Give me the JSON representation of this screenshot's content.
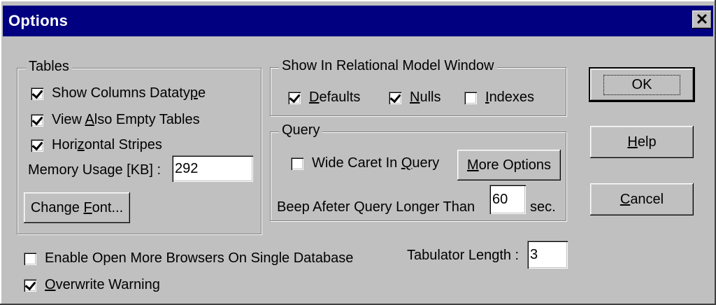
{
  "window": {
    "title": "Options",
    "close_glyph": "✕"
  },
  "tables": {
    "legend": "Tables",
    "show_columns_datatype": {
      "label_pre": "Show Columns Dataty",
      "label_ul": "p",
      "label_post": "e",
      "checked": true
    },
    "view_empty_tables": {
      "label_pre": "View ",
      "label_ul": "A",
      "label_post": "lso Empty Tables",
      "checked": true
    },
    "horizontal_stripes": {
      "label_pre": "Hori",
      "label_ul": "z",
      "label_post": "ontal Stripes",
      "checked": true
    },
    "memory_label": "Memory Usage [KB] :",
    "memory_value": "292",
    "change_font": {
      "pre": "Change ",
      "ul": "F",
      "post": "ont..."
    }
  },
  "relational": {
    "legend": "Show In Relational Model Window",
    "defaults": {
      "ul": "D",
      "rest": "efaults",
      "checked": true
    },
    "nulls": {
      "ul": "N",
      "rest": "ulls",
      "checked": true
    },
    "indexes": {
      "ul": "I",
      "rest": "ndexes",
      "checked": false
    }
  },
  "query": {
    "legend": "Query",
    "wide_caret": {
      "label_pre": "Wide Caret In ",
      "label_ul": "Q",
      "label_post": "uery",
      "checked": false
    },
    "more_options": {
      "ul": "M",
      "rest": "ore Options"
    },
    "beep_label": "Beep Afeter Query Longer Than",
    "beep_value": "60",
    "beep_unit": "sec."
  },
  "bottom": {
    "enable_browsers": {
      "label": "Enable Open More Browsers On Single Database",
      "checked": false
    },
    "overwrite_warning": {
      "ul": "O",
      "rest": "verwrite Warning",
      "checked": true
    },
    "tab_label": "Tabulator Length :",
    "tab_value": "3"
  },
  "buttons": {
    "ok": "OK",
    "help": {
      "ul": "H",
      "rest": "elp"
    },
    "cancel": {
      "ul": "C",
      "rest": "ancel"
    }
  }
}
